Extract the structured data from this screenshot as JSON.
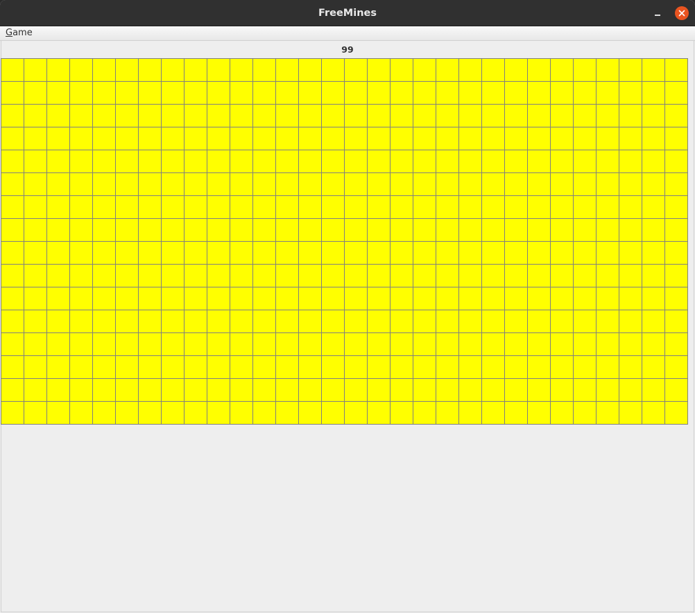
{
  "window": {
    "title": "FreeMines",
    "minimize_icon": "minimize-icon",
    "close_icon": "close-icon",
    "close_color": "#e95420"
  },
  "menubar": {
    "game": {
      "mnemonic": "G",
      "rest": "ame"
    }
  },
  "status": {
    "mines_remaining": "99"
  },
  "board": {
    "columns": 30,
    "rows": 16,
    "cell_state": "covered",
    "covered_color": "#ffff00",
    "grid_color": "#808080"
  }
}
